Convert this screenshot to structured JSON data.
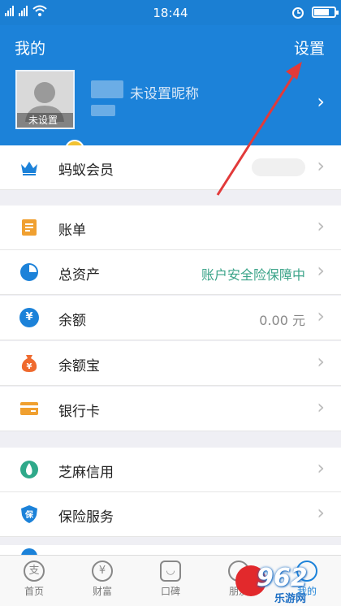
{
  "status_bar": {
    "time": "18:44"
  },
  "header": {
    "title": "我的",
    "settings_label": "设置",
    "nickname": "未设置昵称",
    "avatar_badge": "未设置"
  },
  "member_row": {
    "label": "蚂蚁会员"
  },
  "menu": [
    {
      "name": "bill",
      "label": "账单",
      "value": "",
      "icon": "bill-icon",
      "color": "#f0a030"
    },
    {
      "name": "total-assets",
      "label": "总资产",
      "value": "账户安全险保障中",
      "icon": "pie-chart-icon",
      "color": "#1c82d9"
    },
    {
      "name": "balance",
      "label": "余额",
      "value": "0.00 元",
      "icon": "yen-icon",
      "color": "#1c82d9"
    },
    {
      "name": "yuebao",
      "label": "余额宝",
      "value": "",
      "icon": "money-bag-icon",
      "color": "#ef6a2e"
    },
    {
      "name": "bank-card",
      "label": "银行卡",
      "value": "",
      "icon": "bank-card-icon",
      "color": "#f0a030"
    },
    {
      "name": "sesame-credit",
      "label": "芝麻信用",
      "value": "",
      "icon": "sesame-icon",
      "color": "#2fa98a"
    },
    {
      "name": "insurance",
      "label": "保险服务",
      "value": "",
      "icon": "shield-icon",
      "color": "#1c82d9"
    }
  ],
  "tabs": [
    {
      "label": "首页",
      "glyph": "支"
    },
    {
      "label": "财富",
      "glyph": "¥"
    },
    {
      "label": "口碑",
      "glyph": "◡"
    },
    {
      "label": "朋友",
      "glyph": ""
    },
    {
      "label": "我的",
      "glyph": ""
    }
  ],
  "watermark": {
    "logo_text": "962",
    "sub_text": "乐游网"
  }
}
